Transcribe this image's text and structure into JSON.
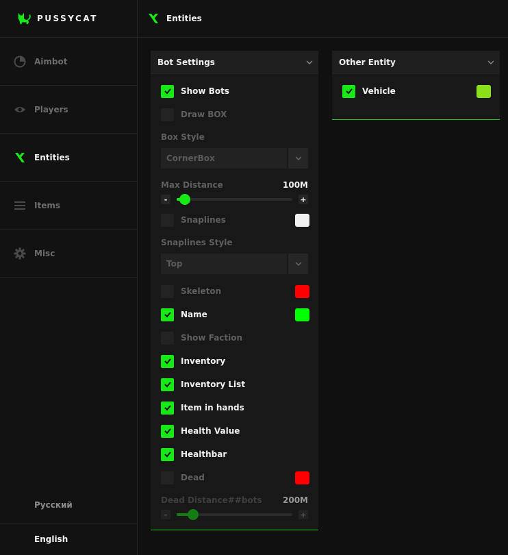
{
  "app": {
    "name": "PUSSYCAT"
  },
  "sidebar": {
    "items": [
      {
        "label": "Aimbot",
        "icon": "aimbot-icon"
      },
      {
        "label": "Players",
        "icon": "eye-icon"
      },
      {
        "label": "Entities",
        "icon": "entities-icon",
        "active": true
      },
      {
        "label": "Items",
        "icon": "menu-icon"
      },
      {
        "label": "Misc",
        "icon": "gear-icon"
      }
    ],
    "languages": [
      "Русский",
      "English"
    ]
  },
  "header": {
    "title": "Entities"
  },
  "bot_settings": {
    "title": "Bot Settings",
    "show_bots": "Show Bots",
    "draw_box": "Draw BOX",
    "box_style_label": "Box Style",
    "box_style_value": "CornerBox",
    "max_distance_label": "Max Distance",
    "max_distance_value": "100M",
    "max_distance_fraction": 0.07,
    "minus": "-",
    "plus": "+",
    "snaplines": "Snaplines",
    "snaplines_style_label": "Snaplines Style",
    "snaplines_style_value": "Top",
    "skeleton": "Skeleton",
    "name": "Name",
    "show_faction": "Show Faction",
    "inventory": "Inventory",
    "inventory_list": "Inventory List",
    "item_in_hands": "Item in hands",
    "health_value": "Health Value",
    "healthbar": "Healthbar",
    "dead": "Dead",
    "dead_distance_label": "Dead Distance##bots",
    "dead_distance_value": "200M",
    "dead_distance_fraction": 0.14
  },
  "other_entity": {
    "title": "Other Entity",
    "vehicle": "Vehicle"
  },
  "colors": {
    "accent": "#16e916",
    "snaplines": "#f0f0f0",
    "skeleton": "#ff0000",
    "name": "#00ff00",
    "dead": "#ff0000",
    "vehicle": "#8ce01a"
  }
}
